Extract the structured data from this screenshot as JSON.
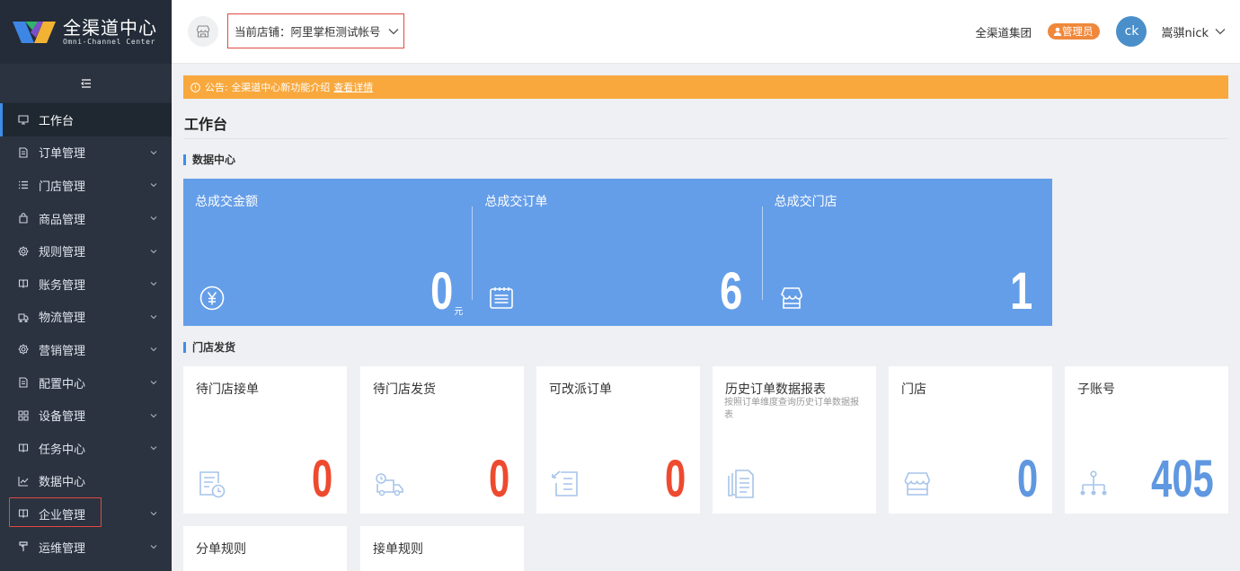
{
  "brand": {
    "name_cn": "全渠道中心",
    "name_en": "Omni-Channel Center"
  },
  "header": {
    "store_label": "当前店铺：阿里掌柜测试帐号",
    "group_name": "全渠道集团",
    "role": "管理员",
    "avatar_initials": "ck",
    "user_name": "嵩骐nick"
  },
  "sidebar": {
    "toggle_icon": "menu-fold-icon",
    "items": [
      {
        "label": "工作台",
        "icon": "monitor-icon",
        "has_children": false
      },
      {
        "label": "订单管理",
        "icon": "document-icon",
        "has_children": true
      },
      {
        "label": "门店管理",
        "icon": "list-icon",
        "has_children": true
      },
      {
        "label": "商品管理",
        "icon": "bag-icon",
        "has_children": true
      },
      {
        "label": "规则管理",
        "icon": "settings-icon",
        "has_children": true
      },
      {
        "label": "账务管理",
        "icon": "book-icon",
        "has_children": true
      },
      {
        "label": "物流管理",
        "icon": "truck-icon",
        "has_children": true
      },
      {
        "label": "营销管理",
        "icon": "settings-icon",
        "has_children": true
      },
      {
        "label": "配置中心",
        "icon": "document-icon",
        "has_children": true
      },
      {
        "label": "设备管理",
        "icon": "grid-icon",
        "has_children": true
      },
      {
        "label": "任务中心",
        "icon": "book-icon",
        "has_children": true
      },
      {
        "label": "数据中心",
        "icon": "chart-icon",
        "has_children": false
      },
      {
        "label": "企业管理",
        "icon": "book-icon",
        "has_children": true
      },
      {
        "label": "运维管理",
        "icon": "tool-icon",
        "has_children": true
      }
    ]
  },
  "notice": {
    "text": "公告: 全渠道中心新功能介绍",
    "link": "查看详情"
  },
  "page_title": "工作台",
  "data_center": {
    "title": "数据中心",
    "stats": [
      {
        "label": "总成交金额",
        "value": "0",
        "unit": "元",
        "icon": "yuan-icon"
      },
      {
        "label": "总成交订单",
        "value": "6",
        "unit": "",
        "icon": "order-notes-icon"
      },
      {
        "label": "总成交门店",
        "value": "1",
        "unit": "",
        "icon": "store-icon"
      }
    ]
  },
  "store_delivery": {
    "title": "门店发货",
    "cards": [
      {
        "label": "待门店接单",
        "desc": "",
        "value": "0",
        "icon": "pending-order-icon",
        "color": "#ee4a2f"
      },
      {
        "label": "待门店发货",
        "desc": "",
        "value": "0",
        "icon": "delivery-truck-icon",
        "color": "#ee4a2f"
      },
      {
        "label": "可改派订单",
        "desc": "",
        "value": "0",
        "icon": "reassign-order-icon",
        "color": "#ee4a2f"
      },
      {
        "label": "历史订单数据报表",
        "desc": "按照订单维度查询历史订单数据报表",
        "value": "",
        "icon": "report-docs-icon",
        "color": ""
      },
      {
        "label": "门店",
        "desc": "",
        "value": "0",
        "icon": "store-icon",
        "color": "#5f98e0"
      },
      {
        "label": "子账号",
        "desc": "",
        "value": "405",
        "icon": "org-tree-icon",
        "color": "#5f98e0"
      }
    ],
    "cards_row2": [
      {
        "label": "分单规则"
      },
      {
        "label": "接单规则"
      }
    ]
  },
  "colors": {
    "sidebar_bg": "#2b3340",
    "accent": "#3d8ee8",
    "notice": "#f8a83d",
    "panel": "#659ee8",
    "alert_red": "#ee4a2f",
    "highlight_box": "#e04a3f"
  }
}
